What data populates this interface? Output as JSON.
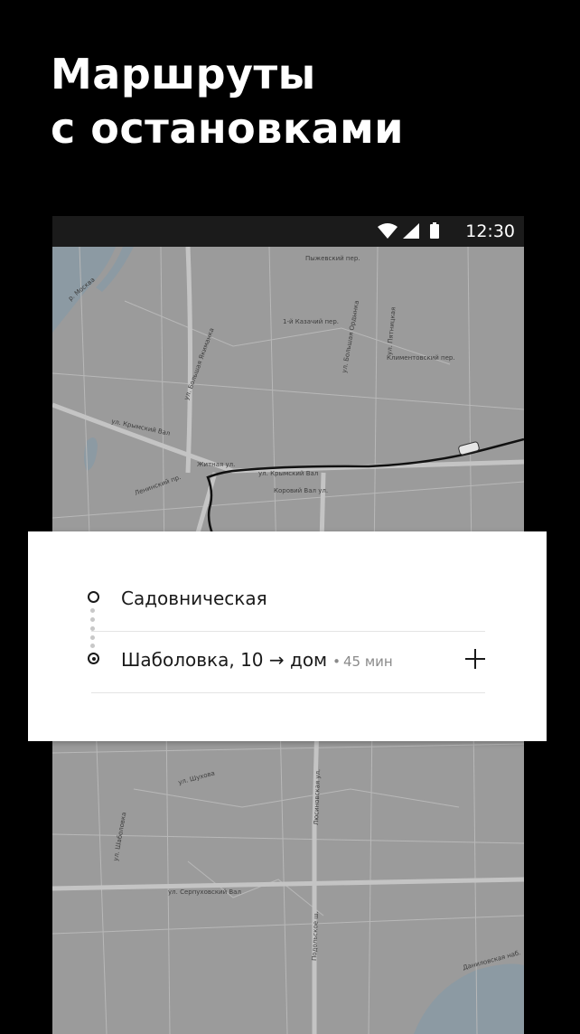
{
  "headline": {
    "line1": "Маршруты",
    "line2": "с остановками"
  },
  "status_bar": {
    "time": "12:30",
    "icons": [
      "wifi-icon",
      "signal-icon",
      "battery-icon"
    ]
  },
  "map": {
    "labels": {
      "krymsky_val": "ул. Крымский Вал",
      "krymsky_val_2": "ул. Крымский Вал",
      "korovy_val": "Коровий Вал ул.",
      "zhitnaya": "Житная ул.",
      "lininsky": "Ленинский пр.",
      "bolshaya_polyanka": "ул. Большая Якиманка",
      "pyatnitskaya": "ул. Пятницкая",
      "bolshaya_ordynka": "ул. Большая Ордынка",
      "lyusinovskaya": "Люсиновская ул.",
      "serpukhovsky_val": "ул. Серпуховский Вал",
      "shabolovka": "ул. Шаболовка",
      "shukhova": "ул. Шухова",
      "podolskoe": "Подольское ш.",
      "danilovskaya": "Даниловская наб.",
      "moskva_river": "р. Москва",
      "kazachiy": "1-й Казачий пер.",
      "pyzhevsky": "Пыжевский пер.",
      "klimentovsky": "Климентовский пер."
    }
  },
  "route_card": {
    "origin": "Садовническая",
    "destination": "Шаболовка, 10 → дом",
    "duration": "45 мин"
  },
  "colors": {
    "background": "#000000",
    "map": "#9b9b9b",
    "card": "#ffffff",
    "text": "#1a1a1a",
    "muted": "#8a8a8a"
  }
}
